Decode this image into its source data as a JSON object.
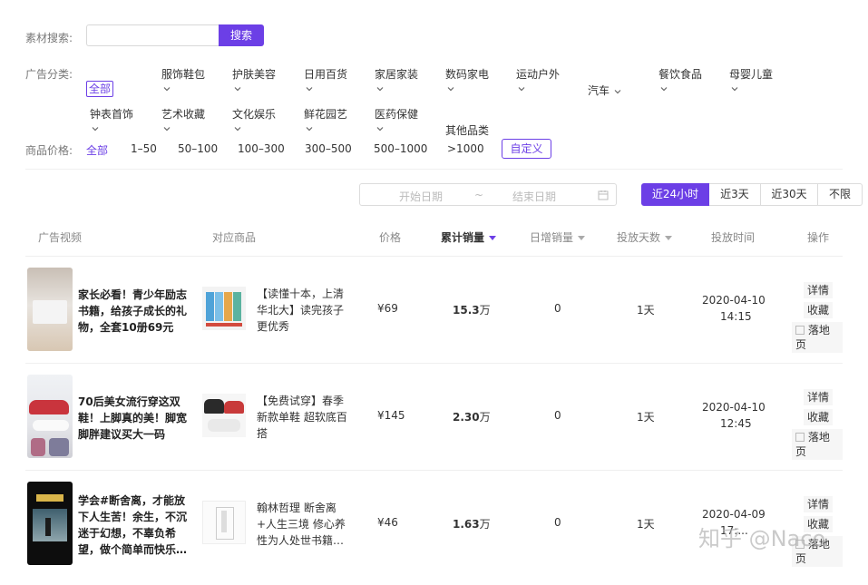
{
  "search": {
    "label": "素材搜索:",
    "value": "",
    "placeholder": "",
    "button": "搜索"
  },
  "category": {
    "label": "广告分类:",
    "all": "全部",
    "items": [
      "服饰鞋包",
      "护肤美容",
      "日用百货",
      "家居家装",
      "数码家电",
      "运动户外",
      "汽车",
      "餐饮食品",
      "母婴儿童",
      "钟表首饰",
      "艺术收藏",
      "文化娱乐",
      "鲜花园艺",
      "医药保健",
      "其他品类"
    ]
  },
  "price": {
    "label": "商品价格:",
    "options": [
      "全部",
      "1–50",
      "50–100",
      "100–300",
      "300–500",
      "500–1000",
      ">1000"
    ],
    "custom": "自定义"
  },
  "date_range": {
    "start_placeholder": "开始日期",
    "separator": "~",
    "end_placeholder": "结束日期"
  },
  "time_filters": [
    "近24小时",
    "近3天",
    "近30天",
    "不限"
  ],
  "columns": [
    "广告视频",
    "对应商品",
    "价格",
    "累计销量",
    "日增销量",
    "投放天数",
    "投放时间",
    "操作"
  ],
  "rows": [
    {
      "ad_title": "家长必看！青少年励志书籍，给孩子成长的礼物，全套10册69元",
      "product": "【读懂十本，上清华北大】读完孩子更优秀",
      "price": "¥69",
      "sales_value": "15.3",
      "sales_unit": "万",
      "daily": "0",
      "days": "1天",
      "date": "2020-04-10",
      "time": "14:15"
    },
    {
      "ad_title": "70后美女流行穿这双鞋！上脚真的美！脚宽脚胖建议买大一码",
      "product": "【免费试穿】春季新款单鞋 超软底百搭",
      "price": "¥145",
      "sales_value": "2.30",
      "sales_unit": "万",
      "daily": "0",
      "days": "1天",
      "date": "2020-04-10",
      "time": "12:45"
    },
    {
      "ad_title": "学会#断舍离，才能放下人生苦！余生，不沉迷于幻想，不辜负希望，做个简单而快乐…",
      "product": "翰林哲理 断舍离+人生三境 修心养性为人处世书籍…",
      "price": "¥46",
      "sales_value": "1.63",
      "sales_unit": "万",
      "daily": "0",
      "days": "1天",
      "date": "2020-04-09",
      "time": "17:..."
    }
  ],
  "actions": [
    "详情",
    "收藏",
    "落地页"
  ],
  "watermark": "知乎 @Naco",
  "colors": {
    "accent": "#6c3fe6"
  }
}
